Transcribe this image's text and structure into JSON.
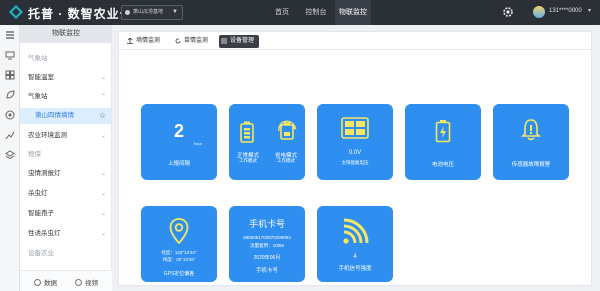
{
  "header": {
    "brand": "托普 · 数智农业云",
    "base_select": "萧山瓜涝基地",
    "nav": [
      {
        "label": "首页",
        "active": false
      },
      {
        "label": "控制台",
        "active": false
      },
      {
        "label": "物联监控",
        "active": true
      }
    ],
    "user": "131****0000"
  },
  "sidebar": {
    "title": "物联监控",
    "items": [
      {
        "label": "气象站",
        "kind": "group"
      },
      {
        "label": "智能温室",
        "kind": "item",
        "chevron": true
      },
      {
        "label": "气象站",
        "kind": "item",
        "chevron": true
      },
      {
        "label": "萧山四情墒情",
        "kind": "sub-active"
      },
      {
        "label": "农业环境监测",
        "kind": "item",
        "chevron": true
      },
      {
        "label": "物保",
        "kind": "group"
      },
      {
        "label": "虫情测报灯",
        "kind": "item",
        "chevron": true
      },
      {
        "label": "杀虫灯",
        "kind": "item",
        "chevron": true
      },
      {
        "label": "智能孢子",
        "kind": "item",
        "chevron": true
      },
      {
        "label": "性诱杀虫灯",
        "kind": "item",
        "chevron": true
      },
      {
        "label": "设备农业",
        "kind": "group"
      }
    ],
    "bottom": {
      "data_label": "数据",
      "video_label": "视频"
    }
  },
  "tabs": [
    {
      "label": "墒情监测",
      "active": false
    },
    {
      "label": "苗情监测",
      "active": false
    },
    {
      "label": "设备管理",
      "active": true
    }
  ],
  "cards": {
    "upload": {
      "value": "2",
      "unit": "hour",
      "label": "上报间隔"
    },
    "mode": {
      "left_title": "正常模式",
      "left_sub": "工作模式",
      "right_title": "省电模式",
      "right_sub": "工作模式"
    },
    "solar": {
      "value": "0.0V",
      "label": "太阳能板电压"
    },
    "battery": {
      "label": "电池电压"
    },
    "alarm": {
      "label": "传感器故障报警"
    },
    "gps": {
      "lon": "经度：120°14'34\"",
      "lat": "纬度：30°13'26\"",
      "label": "GPS定位偏差"
    },
    "sim": {
      "title": "手机卡号",
      "number": "8986061703870299993",
      "traffic": "流量套用：100M",
      "expire": "2029年06月",
      "label": "手机卡号"
    },
    "signal": {
      "value": "4",
      "label": "手机信号强度"
    }
  },
  "colors": {
    "accent": "#2e8ff0",
    "topbar": "#2b2f36",
    "card_icon": "#f5e663"
  }
}
